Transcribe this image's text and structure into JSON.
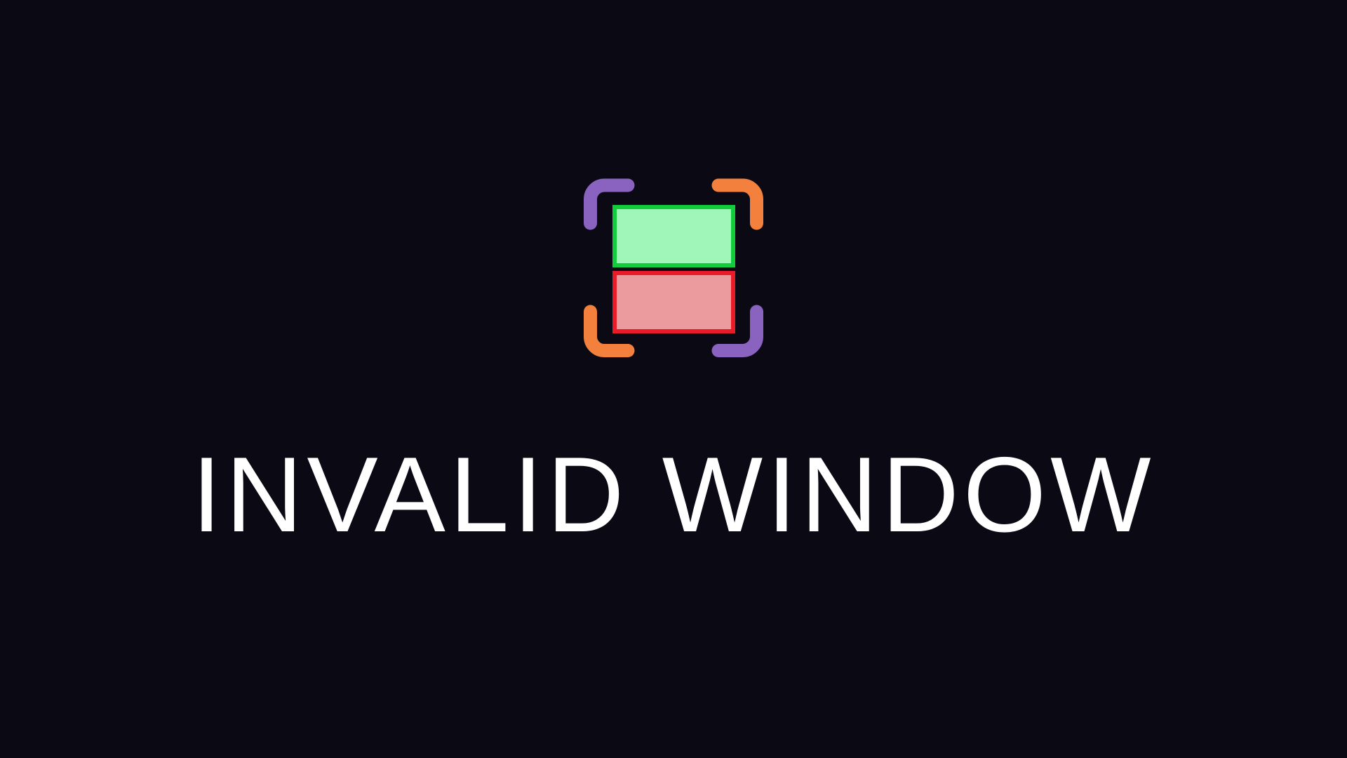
{
  "message": "INVALID WINDOW",
  "icon": {
    "name": "invalid-window-icon",
    "colors": {
      "background": "#0a0914",
      "bracket_purple": "#8a63c0",
      "bracket_orange": "#f3803c",
      "top_fill": "#a0f5b8",
      "top_stroke": "#12cc3c",
      "bottom_fill": "#eb9a9e",
      "bottom_stroke": "#e81c28"
    }
  }
}
